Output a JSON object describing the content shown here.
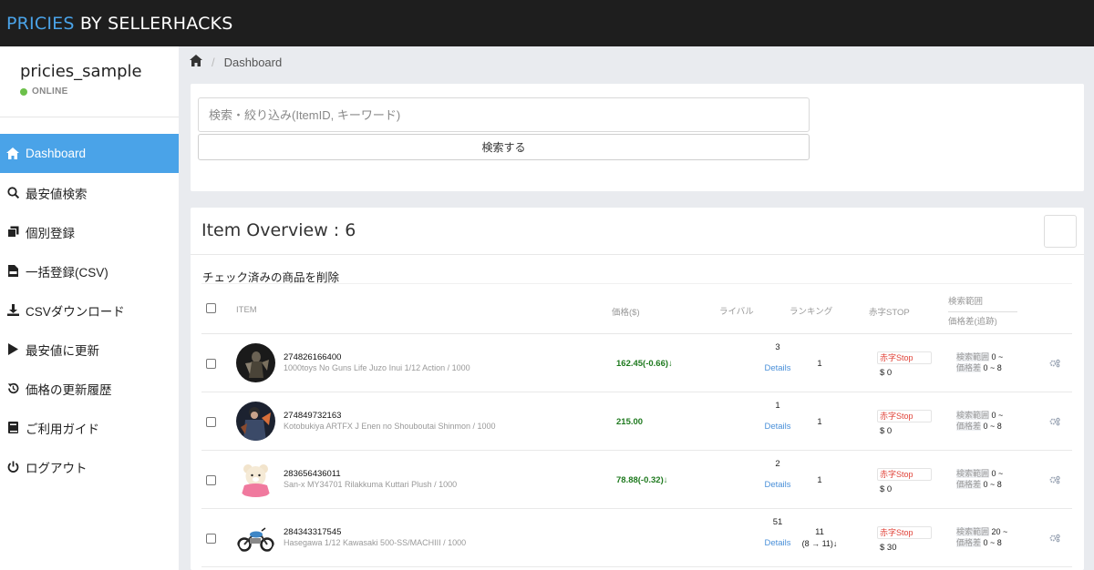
{
  "header": {
    "brand_part1": "PRICIES",
    "brand_part2": " BY SELLERHACKS"
  },
  "sidebar": {
    "username": "pricies_sample",
    "status": "ONLINE",
    "items": [
      {
        "label": "Dashboard",
        "icon": "home-icon",
        "active": true
      },
      {
        "label": "最安値検索",
        "icon": "search-icon",
        "active": false
      },
      {
        "label": "個別登録",
        "icon": "copy-icon",
        "active": false
      },
      {
        "label": "一括登録(CSV)",
        "icon": "csv-file-icon",
        "active": false
      },
      {
        "label": "CSVダウンロード",
        "icon": "download-icon",
        "active": false
      },
      {
        "label": "最安値に更新",
        "icon": "play-icon",
        "active": false
      },
      {
        "label": "価格の更新履歴",
        "icon": "history-icon",
        "active": false
      },
      {
        "label": "ご利用ガイド",
        "icon": "book-icon",
        "active": false
      },
      {
        "label": "ログアウト",
        "icon": "power-icon",
        "active": false
      }
    ]
  },
  "breadcrumb": {
    "current": "Dashboard"
  },
  "search": {
    "placeholder": "検索・絞り込み(ItemID, キーワード)",
    "button_label": "検索する"
  },
  "overview": {
    "title": "Item Overview : 6",
    "delete_label": "チェック済みの商品を削除",
    "columns": {
      "item": "ITEM",
      "price": "価格($)",
      "rival": "ライバル",
      "ranking": "ランキング",
      "stop": "赤字STOP",
      "range_top": "検索範囲",
      "range_bottom": "価格差(追跡)"
    },
    "rows": [
      {
        "id": "274826166400",
        "name": "1000toys No Guns Life Juzo Inui 1/12 Action / 1000",
        "price": "162.45(-0.66)↓",
        "rival": "3",
        "details": "Details",
        "rank": "1",
        "rank_sub": "",
        "stop": "赤字Stop",
        "amount": "$ 0",
        "range_label": "検索範囲",
        "range_value": "0 ~",
        "diff_label": "価格差",
        "diff_value": "0 ~ 8",
        "thumb": "figure"
      },
      {
        "id": "274849732163",
        "name": "Kotobukiya ARTFX J Enen no Shouboutai Shinmon / 1000",
        "price": "215.00",
        "rival": "1",
        "details": "Details",
        "rank": "1",
        "rank_sub": "",
        "stop": "赤字Stop",
        "amount": "$ 0",
        "range_label": "検索範囲",
        "range_value": "0 ~",
        "diff_label": "価格差",
        "diff_value": "0 ~ 8",
        "thumb": "statue"
      },
      {
        "id": "283656436011",
        "name": "San-x MY34701 Rilakkuma Kuttari Plush / 1000",
        "price": "78.88(-0.32)↓",
        "rival": "2",
        "details": "Details",
        "rank": "1",
        "rank_sub": "",
        "stop": "赤字Stop",
        "amount": "$ 0",
        "range_label": "検索範囲",
        "range_value": "0 ~",
        "diff_label": "価格差",
        "diff_value": "0 ~ 8",
        "thumb": "plush"
      },
      {
        "id": "284343317545",
        "name": "Hasegawa 1/12 Kawasaki 500-SS/MACHIII / 1000",
        "price": "",
        "rival": "51",
        "details": "Details",
        "rank": "11",
        "rank_sub": "(8 → 11)↓",
        "stop": "赤字Stop",
        "amount": "$ 30",
        "range_label": "検索範囲",
        "range_value": "20 ~",
        "diff_label": "価格差",
        "diff_value": "0 ~ 8",
        "thumb": "motorcycle"
      }
    ]
  },
  "colors": {
    "accent": "#4aa3e8",
    "topbar": "#1e1e1e",
    "price_green": "#1f7a1f",
    "stop_red": "#e0443a",
    "link_blue": "#4a90d9"
  }
}
